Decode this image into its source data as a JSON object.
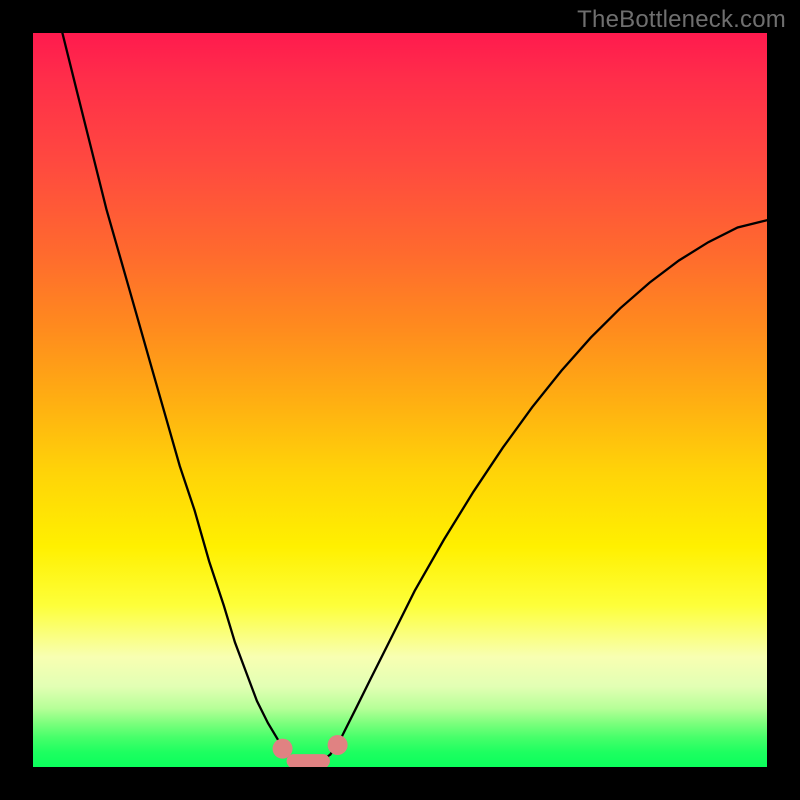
{
  "attribution": "TheBottleneck.com",
  "chart_data": {
    "type": "line",
    "title": "",
    "xlabel": "",
    "ylabel": "",
    "xlim": [
      0,
      100
    ],
    "ylim": [
      0,
      100
    ],
    "series": [
      {
        "name": "left-curve",
        "x": [
          4,
          6,
          8,
          10,
          12,
          14,
          16,
          18,
          20,
          22,
          24,
          26,
          27.5,
          29,
          30.5,
          32,
          33.5,
          34.5,
          35
        ],
        "y": [
          100,
          92,
          84,
          76,
          69,
          62,
          55,
          48,
          41,
          35,
          28,
          22,
          17,
          13,
          9,
          6,
          3.5,
          2,
          1.3
        ]
      },
      {
        "name": "bottom-segment",
        "x": [
          35,
          37,
          39,
          40.5
        ],
        "y": [
          1.3,
          0.5,
          0.6,
          1.7
        ]
      },
      {
        "name": "right-curve",
        "x": [
          40.5,
          42,
          44,
          46,
          49,
          52,
          56,
          60,
          64,
          68,
          72,
          76,
          80,
          84,
          88,
          92,
          96,
          100
        ],
        "y": [
          1.7,
          4,
          8,
          12,
          18,
          24,
          31,
          37.5,
          43.5,
          49,
          54,
          58.5,
          62.5,
          66,
          69,
          71.5,
          73.5,
          74.5
        ]
      }
    ],
    "annotations": [
      {
        "name": "marker-left",
        "x": 34.0,
        "y": 2.5
      },
      {
        "name": "marker-right",
        "x": 41.5,
        "y": 3.0
      },
      {
        "name": "marker-bridge-start",
        "x": 35.5,
        "y": 0.8
      },
      {
        "name": "marker-bridge-end",
        "x": 39.5,
        "y": 0.8
      }
    ]
  }
}
